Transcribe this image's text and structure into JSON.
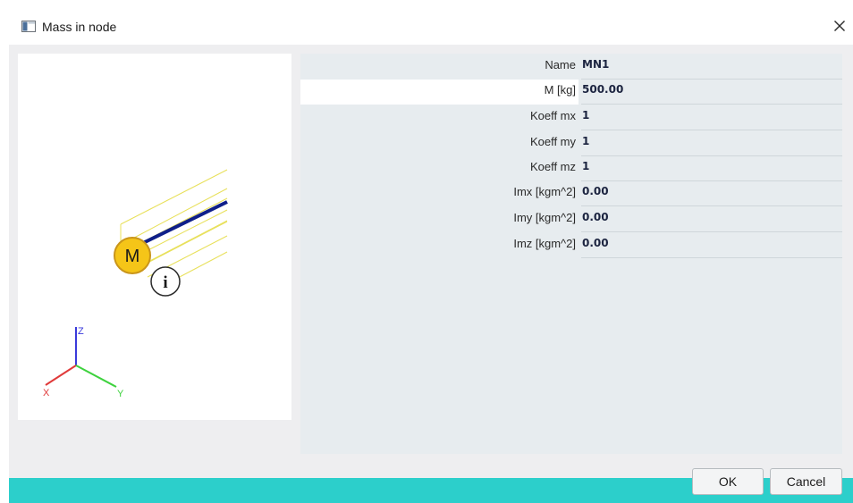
{
  "window": {
    "title": "Mass in node",
    "close_glyph": "✕"
  },
  "preview": {
    "mass_symbol": "M",
    "info_symbol": "i",
    "axes": {
      "z": "Z",
      "x": "X",
      "y": "Y"
    },
    "colors": {
      "beam_outline": "#e8e05a",
      "beam_axis": "#0f1f8a",
      "mass_fill": "#f5c518",
      "mass_stroke": "#c9951a",
      "axis_z": "#3a3adb",
      "axis_x": "#e03a3a",
      "axis_y": "#3ed23e"
    }
  },
  "properties": [
    {
      "label": "Name",
      "value": "MN1"
    },
    {
      "label": "M [kg]",
      "value": "500.00"
    },
    {
      "label": "Koeff mx",
      "value": "1"
    },
    {
      "label": "Koeff my",
      "value": "1"
    },
    {
      "label": "Koeff mz",
      "value": "1"
    },
    {
      "label": "Imx [kgm^2]",
      "value": "0.00"
    },
    {
      "label": "Imy [kgm^2]",
      "value": "0.00"
    },
    {
      "label": "Imz [kgm^2]",
      "value": "0.00"
    }
  ],
  "buttons": {
    "ok": "OK",
    "cancel": "Cancel"
  },
  "colors": {
    "accent_strip": "#2ccfcb"
  }
}
